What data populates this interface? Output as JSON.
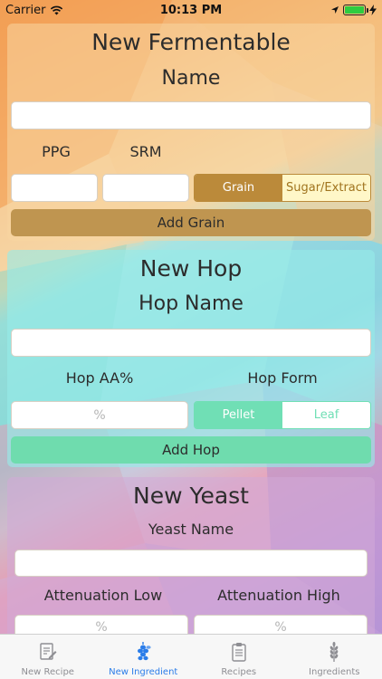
{
  "status_bar": {
    "carrier": "Carrier",
    "time": "10:13 PM"
  },
  "fermentable": {
    "title": "New Fermentable",
    "name_label": "Name",
    "name_value": "",
    "ppg_label": "PPG",
    "srm_label": "SRM",
    "ppg_value": "",
    "srm_value": "",
    "type_options": [
      "Grain",
      "Sugar/Extract"
    ],
    "selected_type": "Grain",
    "add_button": "Add Grain",
    "colors": {
      "selected": "#bb8a3a",
      "unselected_text": "#a0741e",
      "unselected_bg": "#fff7c8",
      "button": "#bf9550"
    }
  },
  "hop": {
    "title": "New Hop",
    "name_label": "Hop Name",
    "name_value": "",
    "aa_label": "Hop AA%",
    "form_label": "Hop Form",
    "aa_placeholder": "%",
    "form_options": [
      "Pellet",
      "Leaf"
    ],
    "selected_form": "Pellet",
    "add_button": "Add Hop",
    "colors": {
      "selected": "#70dfb5",
      "unselected_text": "#70dfb5",
      "button": "#6fdcae"
    }
  },
  "yeast": {
    "title": "New Yeast",
    "name_label": "Yeast Name",
    "name_value": "",
    "atten_low_label": "Attenuation Low",
    "atten_high_label": "Attenuation High",
    "atten_low_placeholder": "%",
    "atten_high_placeholder": "%"
  },
  "tab_bar": {
    "tabs": [
      {
        "label": "New Recipe",
        "icon": "edit-document-icon"
      },
      {
        "label": "New Ingredient",
        "icon": "hops-icon"
      },
      {
        "label": "Recipes",
        "icon": "clipboard-icon"
      },
      {
        "label": "Ingredients",
        "icon": "wheat-icon"
      }
    ],
    "active": "New Ingredient"
  }
}
